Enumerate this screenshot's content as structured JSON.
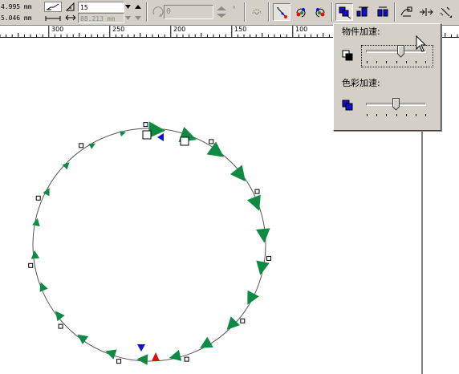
{
  "toolbar": {
    "pos_x": "4.995 mm",
    "pos_y": "5.046 mm",
    "steps_value": "15",
    "spacing_value": "88.213 mm",
    "rotation_value": "0",
    "rotation_unit": "°"
  },
  "ruler": {
    "labels": [
      "300",
      "250",
      "200",
      "150",
      "100"
    ]
  },
  "popup": {
    "object_accel_label": "物件加速:",
    "color_accel_label": "色彩加速:",
    "object_accel_level": 0.58,
    "color_accel_level": 0.5
  },
  "icons": {
    "accent_green": "#0f8a45",
    "accent_blue": "#1010d0",
    "accent_red": "#e01010"
  }
}
